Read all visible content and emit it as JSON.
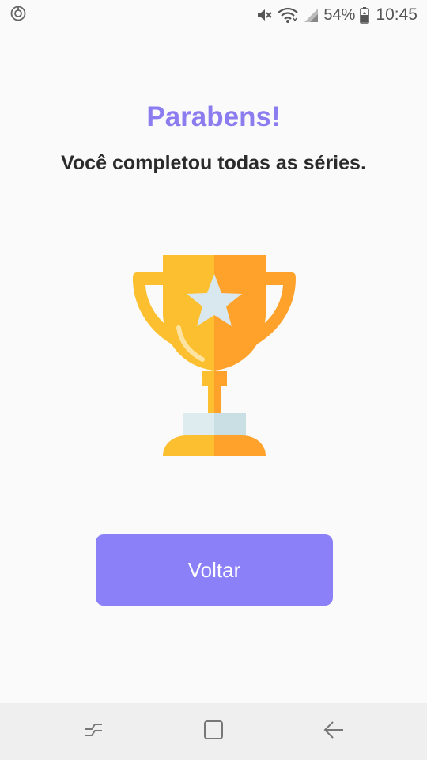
{
  "status_bar": {
    "battery_percent": "54%",
    "time": "10:45",
    "icons": [
      "sync-icon",
      "mute-icon",
      "wifi-icon",
      "signal-icon",
      "battery-icon"
    ]
  },
  "screen": {
    "title": "Parabens!",
    "subtitle": "Você completou todas as séries.",
    "illustration": "trophy-icon",
    "back_button_label": "Voltar"
  },
  "nav_bar": {
    "icons": [
      "recent-apps-icon",
      "home-icon",
      "back-icon"
    ]
  },
  "colors": {
    "accent": "#8b7cf0",
    "button": "#8c80f8",
    "trophy_light": "#fbbf2f",
    "trophy_dark": "#ffa22b",
    "star": "#d8e8ee"
  }
}
